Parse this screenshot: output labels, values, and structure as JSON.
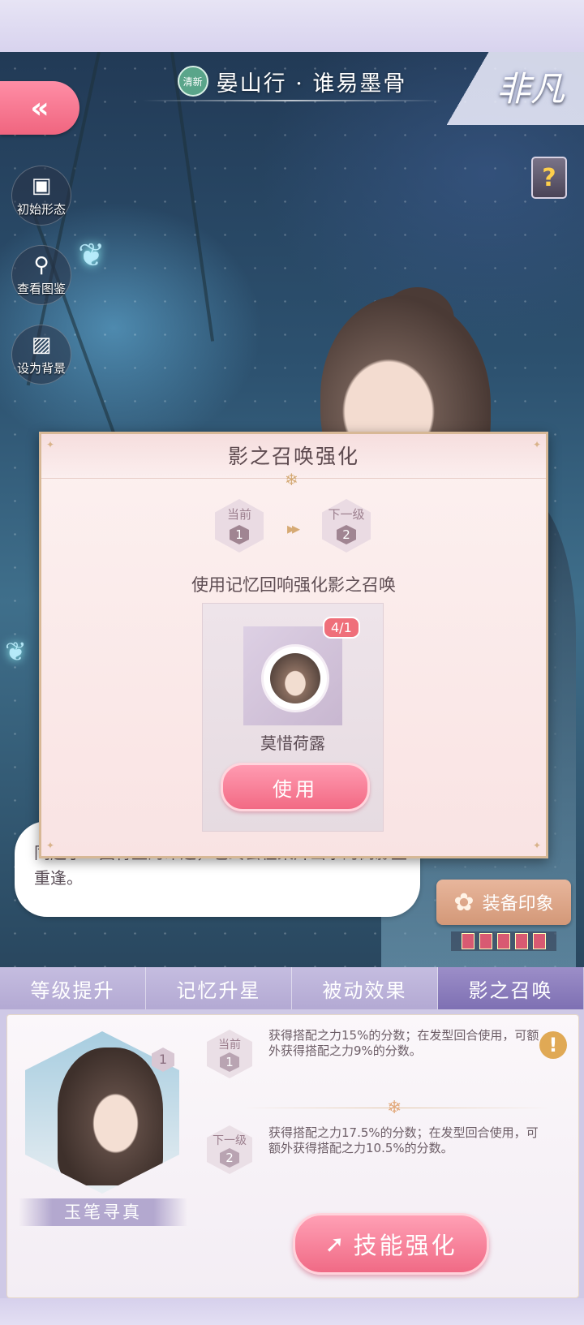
{
  "header": {
    "badge": "清新",
    "title": "晏山行 · 谁易墨骨",
    "rarity": "非凡"
  },
  "side_buttons": {
    "initial_form": "初始形态",
    "view_gallery": "查看图鉴",
    "set_background": "设为背景"
  },
  "icons": {
    "back": "double-chevron-left-icon",
    "help": "question-book-icon"
  },
  "dialogue": "同起于一团青墨的命运，也终会在某片山水的倒影里重逢。",
  "equip_label": "装备印象",
  "modal": {
    "title": "影之召唤强化",
    "current_label": "当前",
    "current_level": "1",
    "next_label": "下一级",
    "next_level": "2",
    "description": "使用记忆回响强化影之召唤",
    "item_count": "4/1",
    "item_name": "莫惜荷露",
    "use_label": "使用"
  },
  "tabs": [
    "等级提升",
    "记忆升星",
    "被动效果",
    "影之召唤"
  ],
  "active_tab": 3,
  "skill": {
    "name": "玉笔寻真",
    "level": "1",
    "current_label": "当前",
    "current_level": "1",
    "current_effect": "获得搭配之力15%的分数；在发型回合使用，可额外获得搭配之力9%的分数。",
    "next_label": "下一级",
    "next_level": "2",
    "next_effect": "获得搭配之力17.5%的分数；在发型回合使用，可额外获得搭配之力10.5%的分数。",
    "upgrade_label": "技能强化"
  },
  "colors": {
    "accent_pink": "#f26a84",
    "tab_active": "#7e70b3",
    "frame_gold": "#d7b896"
  }
}
